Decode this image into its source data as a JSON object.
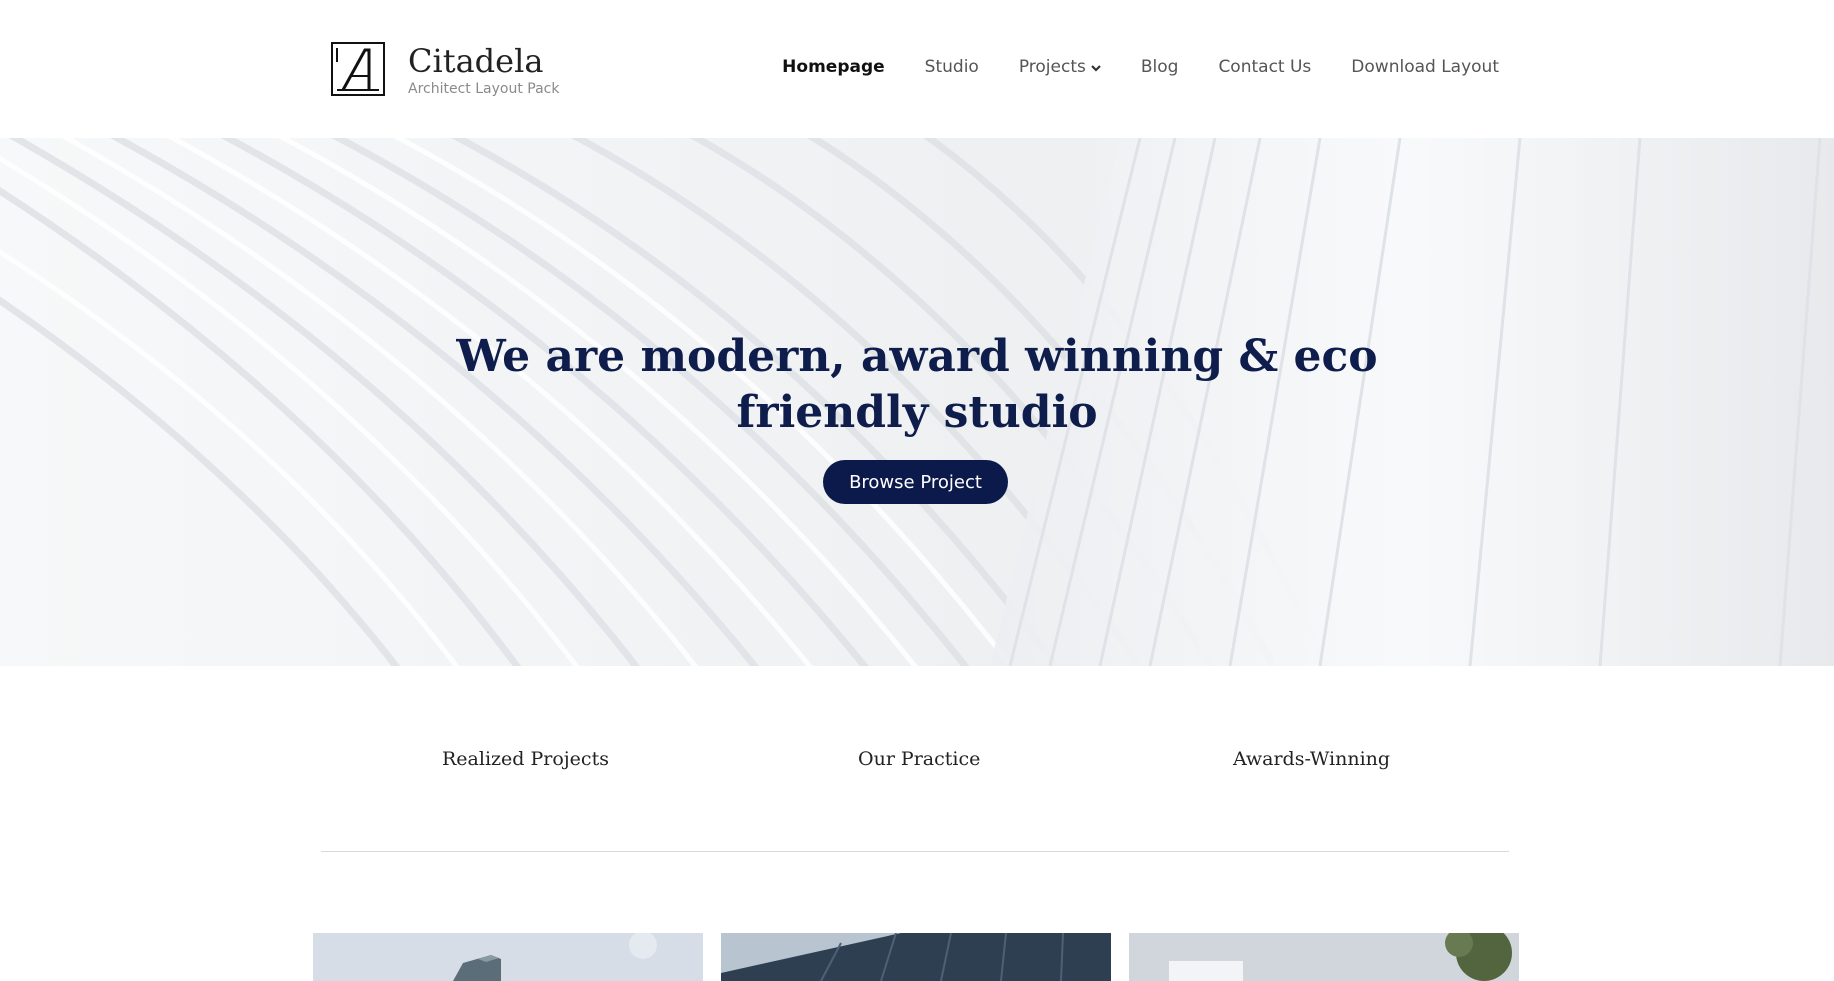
{
  "brand": {
    "name": "Citadela",
    "tagline": "Architect Layout Pack"
  },
  "nav": {
    "items": [
      {
        "label": "Homepage",
        "active": true
      },
      {
        "label": "Studio"
      },
      {
        "label": "Projects",
        "icon": "chevron-down-icon"
      },
      {
        "label": "Blog"
      },
      {
        "label": "Contact Us"
      },
      {
        "label": "Download Layout"
      }
    ]
  },
  "hero": {
    "title_line1": "We are modern, award winning & eco",
    "title_line2": "friendly studio",
    "cta": "Browse Project"
  },
  "features": [
    "Realized Projects",
    "Our Practice",
    "Awards-Winning"
  ],
  "colors": {
    "accent": "#0b1a4a",
    "title": "#0e1d4c",
    "nav_text": "#555555"
  }
}
